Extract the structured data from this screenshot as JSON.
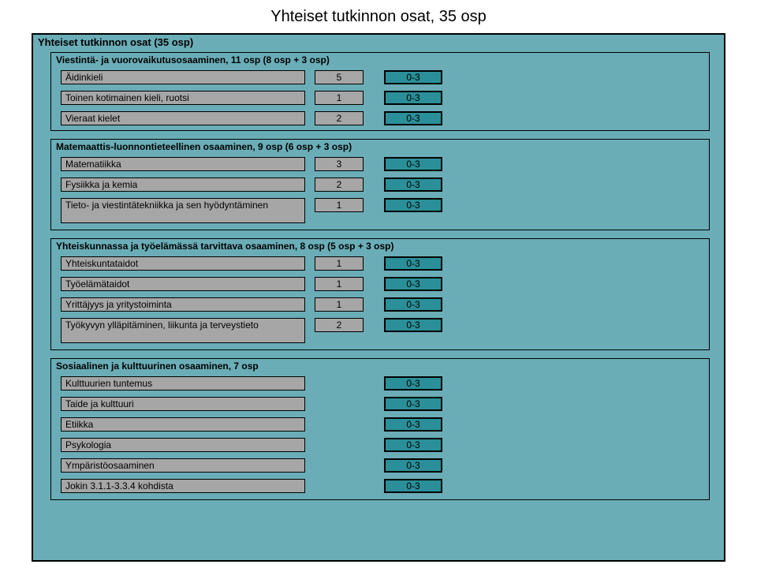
{
  "title": "Yhteiset tutkinnon osat, 35 osp",
  "outer": {
    "label": "Yhteiset tutkinnon osat (35 osp)"
  },
  "sections": {
    "s1": {
      "title": "Viestintä- ja vuorovaikutusosaaminen, 11 osp (8 osp + 3 osp)",
      "rows": [
        {
          "name": "Äidinkieli",
          "credits": "5",
          "range": "0-3"
        },
        {
          "name": "Toinen kotimainen kieli, ruotsi",
          "credits": "1",
          "range": "0-3"
        },
        {
          "name": "Vieraat kielet",
          "credits": "2",
          "range": "0-3"
        }
      ]
    },
    "s2": {
      "title": "Matemaattis-luonnontieteellinen osaaminen, 9 osp (6 osp + 3 osp)",
      "rows": [
        {
          "name": "Matematiikka",
          "credits": "3",
          "range": "0-3"
        },
        {
          "name": "Fysiikka ja kemia",
          "credits": "2",
          "range": "0-3"
        },
        {
          "name": "Tieto- ja viestintätekniikka ja sen hyödyntäminen",
          "credits": "1",
          "range": "0-3"
        }
      ]
    },
    "s3": {
      "title": "Yhteiskunnassa ja työelämässä tarvittava osaaminen, 8 osp (5 osp + 3 osp)",
      "rows": [
        {
          "name": "Yhteiskuntataidot",
          "credits": "1",
          "range": "0-3"
        },
        {
          "name": "Työelämätaidot",
          "credits": "1",
          "range": "0-3"
        },
        {
          "name": "Yrittäjyys ja yritystoiminta",
          "credits": "1",
          "range": "0-3"
        },
        {
          "name": "Työkyvyn ylläpitäminen, liikunta ja terveystieto",
          "credits": "2",
          "range": "0-3"
        }
      ]
    },
    "s4": {
      "title": "Sosiaalinen ja kulttuurinen osaaminen, 7 osp",
      "rows": [
        {
          "name": "Kulttuurien tuntemus",
          "range": "0-3"
        },
        {
          "name": "Taide ja kulttuuri",
          "range": "0-3"
        },
        {
          "name": "Etiikka",
          "range": "0-3"
        },
        {
          "name": "Psykologia",
          "range": "0-3"
        },
        {
          "name": "Ympäristöosaaminen",
          "range": "0-3"
        },
        {
          "name": "Jokin 3.1.1-3.3.4 kohdista",
          "range": "0-3"
        }
      ]
    }
  }
}
